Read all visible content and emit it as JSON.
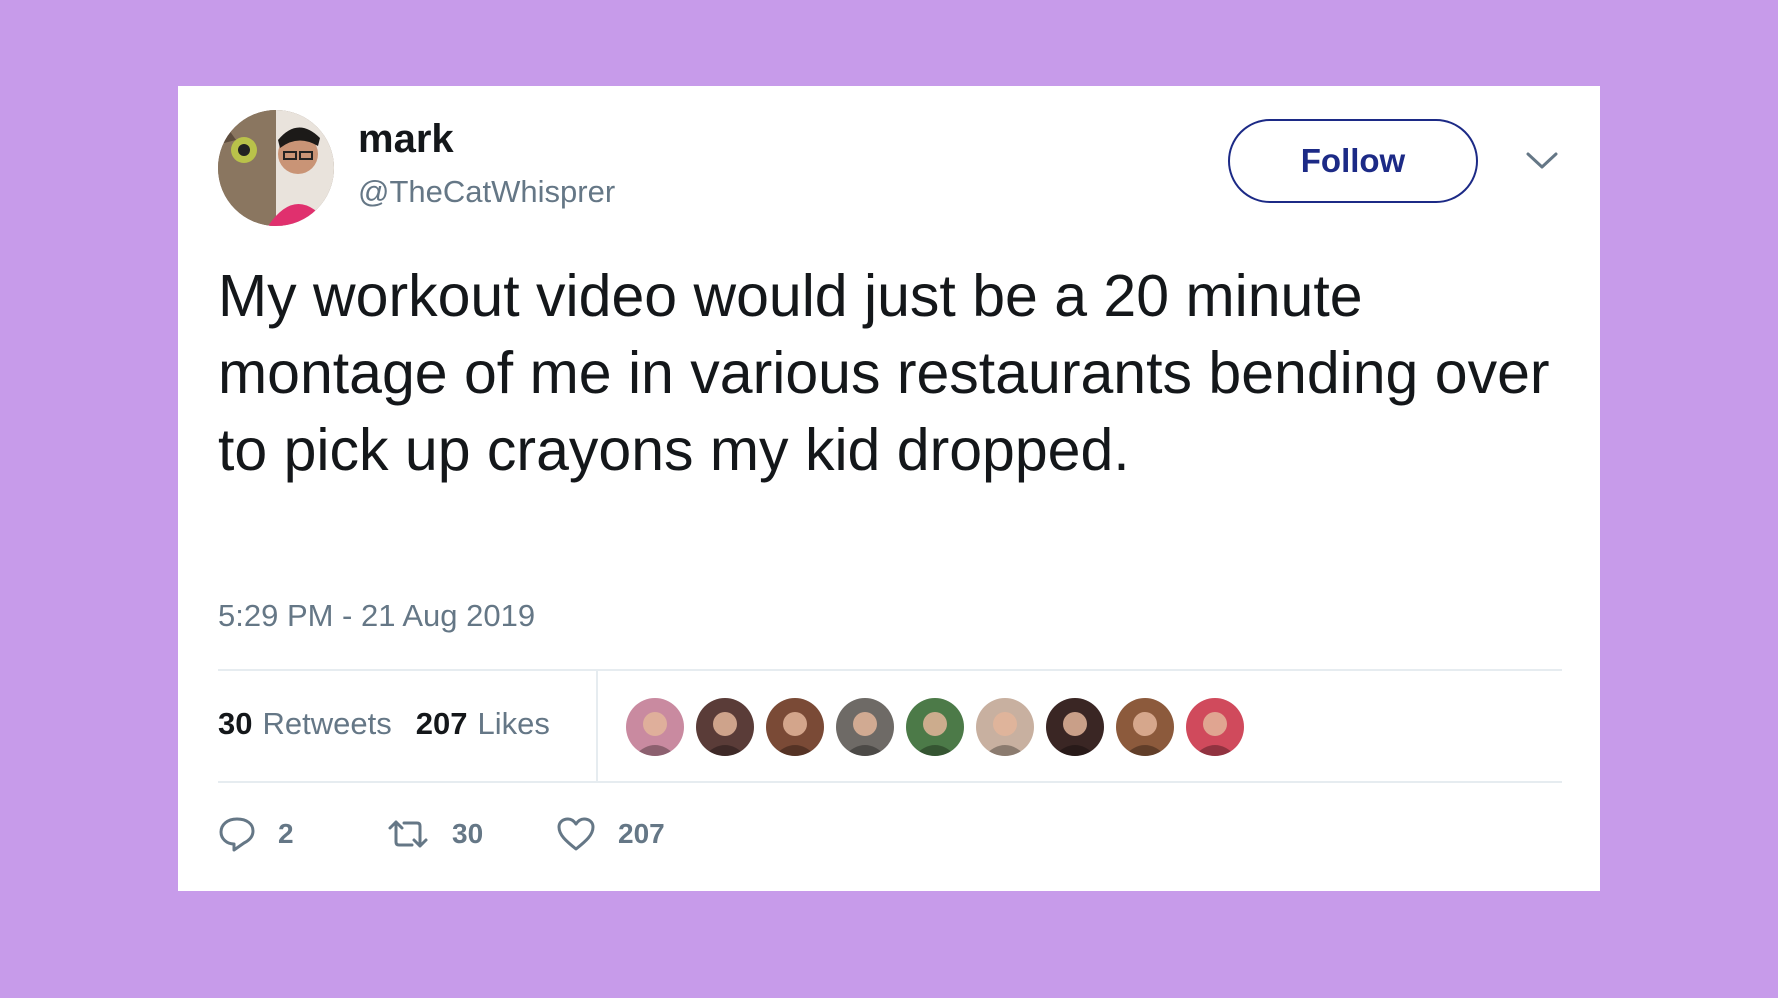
{
  "colors": {
    "background": "#c79bea",
    "card": "#ffffff",
    "follow_border": "#1c2a86",
    "text_primary": "#14171a",
    "text_secondary": "#657786"
  },
  "author": {
    "display_name": "mark",
    "handle": "@TheCatWhisprer",
    "avatar_icon": "avatar-icon"
  },
  "header": {
    "follow_label": "Follow",
    "menu_icon": "chevron-down-icon"
  },
  "tweet": {
    "text": "My workout video would just be a 20 minute montage of me in various restaurants bending over to pick up crayons my kid dropped.",
    "timestamp": "5:29 PM - 21 Aug 2019"
  },
  "stats": {
    "retweets_count": "30",
    "retweets_label": "Retweets",
    "likes_count": "207",
    "likes_label": "Likes"
  },
  "likers": [
    {
      "icon": "liker-avatar-icon",
      "color": "#c98aa0"
    },
    {
      "icon": "liker-avatar-icon",
      "color": "#5a3c38"
    },
    {
      "icon": "liker-avatar-icon",
      "color": "#7a4a36"
    },
    {
      "icon": "liker-avatar-icon",
      "color": "#6e6a66"
    },
    {
      "icon": "liker-avatar-icon",
      "color": "#4c7a48"
    },
    {
      "icon": "liker-avatar-icon",
      "color": "#c8b0a0"
    },
    {
      "icon": "liker-avatar-icon",
      "color": "#3a2624"
    },
    {
      "icon": "liker-avatar-icon",
      "color": "#8c5a3c"
    },
    {
      "icon": "liker-avatar-icon",
      "color": "#d04a5c"
    }
  ],
  "actions": {
    "reply_count": "2",
    "retweet_count": "30",
    "like_count": "207"
  }
}
